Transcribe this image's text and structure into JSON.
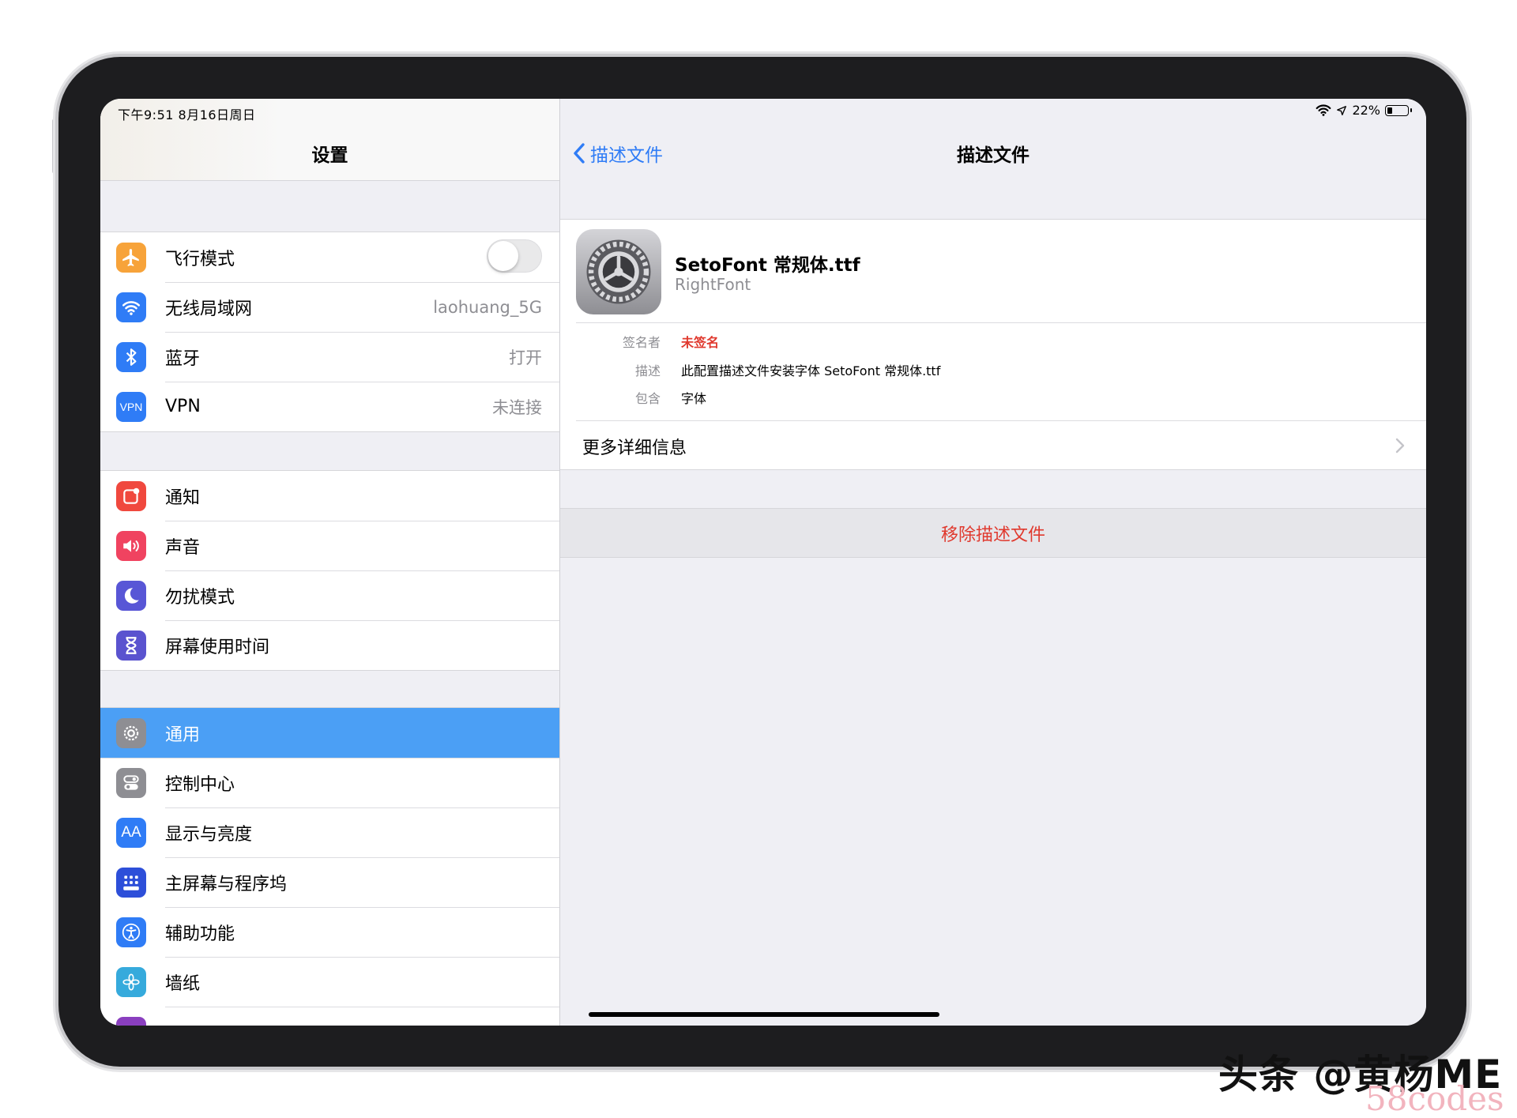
{
  "status": {
    "time_date": "下午9:51   8月16日周日",
    "battery": "22%"
  },
  "sidebar": {
    "title": "设置",
    "groups": [
      {
        "items": [
          {
            "label": "飞行模式",
            "icon": "airplane-icon",
            "color": "#f7a33a"
          },
          {
            "label": "无线局域网",
            "value": "laohuang_5G",
            "icon": "wifi-icon",
            "color": "#2f7cf6"
          },
          {
            "label": "蓝牙",
            "value": "打开",
            "icon": "bluetooth-icon",
            "color": "#2f7cf6"
          },
          {
            "label": "VPN",
            "value": "未连接",
            "icon": "vpn-icon",
            "icon_text": "VPN",
            "color": "#2f7cf6"
          }
        ]
      },
      {
        "items": [
          {
            "label": "通知",
            "icon": "notification-icon",
            "color": "#f0483e"
          },
          {
            "label": "声音",
            "icon": "speaker-icon",
            "color": "#f04360"
          },
          {
            "label": "勿扰模式",
            "icon": "moon-icon",
            "color": "#5856d6"
          },
          {
            "label": "屏幕使用时间",
            "icon": "hourglass-icon",
            "color": "#5a53cf"
          }
        ]
      },
      {
        "items": [
          {
            "label": "通用",
            "icon": "gear-icon",
            "color": "#8e8e93"
          },
          {
            "label": "控制中心",
            "icon": "switches-icon",
            "color": "#8e8e93"
          },
          {
            "label": "显示与亮度",
            "icon": "text-size-icon",
            "icon_text": "AA",
            "color": "#2f7cf6"
          },
          {
            "label": "主屏幕与程序坞",
            "icon": "app-grid-icon",
            "color": "#2d4fd9"
          },
          {
            "label": "辅助功能",
            "icon": "accessibility-icon",
            "color": "#2f7cf6"
          },
          {
            "label": "墙纸",
            "icon": "flower-icon",
            "color": "#36aadc"
          }
        ]
      }
    ]
  },
  "detail": {
    "back_label": "描述文件",
    "title": "描述文件",
    "profile": {
      "name": "SetoFont 常规体.ttf",
      "org": "RightFont"
    },
    "info": [
      {
        "key": "签名者",
        "value": "未签名"
      },
      {
        "key": "描述",
        "value": "此配置描述文件安装字体 SetoFont 常规体.ttf"
      },
      {
        "key": "包含",
        "value": "字体"
      }
    ],
    "more_label": "更多详细信息",
    "remove_label": "移除描述文件"
  },
  "watermark": {
    "text": "头条 @黄杨ME",
    "site": "58codes"
  },
  "colors": {
    "accent": "#2f7cf6",
    "selected": "#4b9ff5",
    "destructive": "#e0392e"
  }
}
